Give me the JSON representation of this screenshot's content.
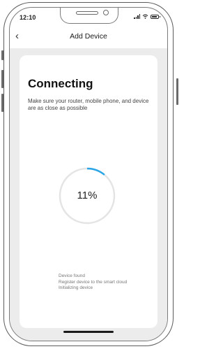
{
  "status_bar": {
    "time": "12:10"
  },
  "header": {
    "back_icon": "chevron-left-icon",
    "title": "Add Device"
  },
  "card": {
    "heading": "Connecting",
    "description": "Make sure your router, mobile phone, and device are as close as possible",
    "progress": {
      "percent_label": "11%",
      "value": 0.11,
      "track_color": "#e4e4e4",
      "fill_color": "#2aa5e6"
    },
    "steps": [
      "Device found",
      "Register device to the smart cloud",
      "Initializing device"
    ]
  }
}
